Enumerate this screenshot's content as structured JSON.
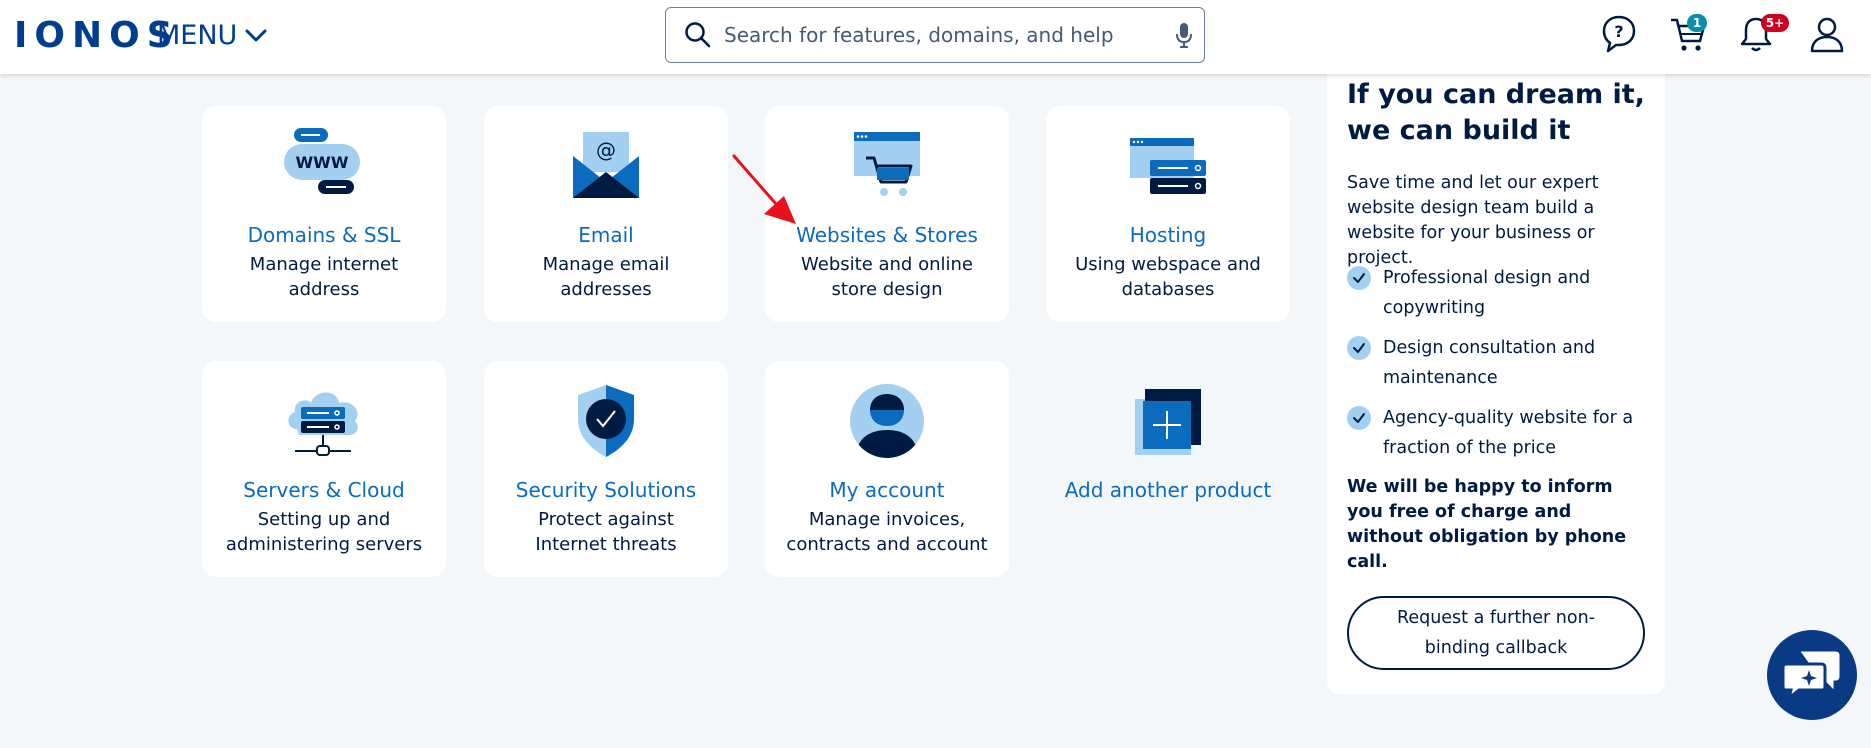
{
  "header": {
    "logo": "IONOS",
    "menu_label": "MENU",
    "search_placeholder": "Search for features, domains, and help",
    "cart_count": "1",
    "notifications_count": "5+"
  },
  "cards": [
    {
      "title": "Domains & SSL",
      "desc": "Manage internet address"
    },
    {
      "title": "Email",
      "desc": "Manage email addresses"
    },
    {
      "title": "Websites & Stores",
      "desc": "Website and online store design"
    },
    {
      "title": "Hosting",
      "desc": "Using webspace and databases"
    },
    {
      "title": "Servers & Cloud",
      "desc": "Setting up and administering servers"
    },
    {
      "title": "Security Solutions",
      "desc": "Protect against Internet threats"
    },
    {
      "title": "My account",
      "desc": "Manage invoices, contracts and account"
    },
    {
      "title": "Add another product",
      "desc": ""
    }
  ],
  "panel": {
    "heading": "If you can dream it, we can build it",
    "intro": "Save time and let our expert website design team build a website for your business or project.",
    "benefits": [
      "Professional design and copywriting",
      "Design consultation and maintenance",
      "Agency-quality website for a fraction of the price"
    ],
    "cta_text": "We will be happy to inform you free of charge and without obligation by phone call.",
    "button_label": "Request a further non-binding callback"
  },
  "colors": {
    "brand": "#003d8f",
    "link": "#0b6bbd",
    "background": "#f4f7fa",
    "badge_cart": "#0b8fa8",
    "badge_notifications": "#d00020"
  }
}
